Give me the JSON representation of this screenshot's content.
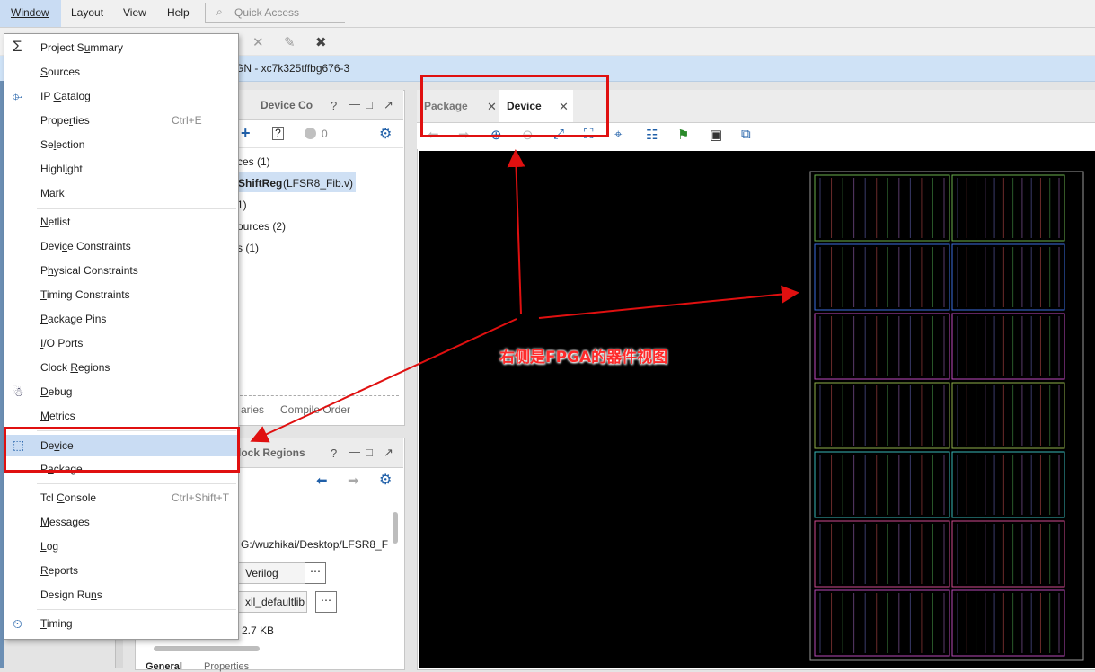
{
  "menubar": {
    "window": "Window",
    "layout": "Layout",
    "view": "View",
    "help": "Help",
    "quick_access": "Quick Access"
  },
  "project_bar": {
    "title": "GN - xc7k325tffbg676-3"
  },
  "sources_panel": {
    "tabs": [
      "t",
      "Device Co"
    ],
    "badge_count": "0",
    "rows": [
      "ces (1)",
      "ShiftReg",
      "(LFSR8_Fib.v)",
      "1)",
      "ources (2)",
      "s (1)"
    ],
    "footer_tabs": [
      "aries",
      "Compile Order"
    ]
  },
  "properties_panel": {
    "tab": "lock Regions",
    "location": "G:/wuzhikai/Desktop/LFSR8_F",
    "file_type": "Verilog",
    "library": "xil_defaultlib",
    "size": "2.7 KB",
    "bottom_tabs": [
      "General",
      "Properties"
    ]
  },
  "device_panel": {
    "tabs": [
      "Package",
      "Device"
    ],
    "active_tab": "Device"
  },
  "window_menu": {
    "items": [
      {
        "label": "Project Summary",
        "icon": "sigma-icon"
      },
      {
        "label": "Sources",
        "icon": ""
      },
      {
        "label": "IP Catalog",
        "icon": "ip-plug-icon"
      },
      {
        "label": "Properties",
        "shortcut": "Ctrl+E"
      },
      {
        "label": "Selection"
      },
      {
        "label": "Highlight"
      },
      {
        "label": "Mark"
      },
      {
        "label": "Netlist"
      },
      {
        "label": "Device Constraints"
      },
      {
        "label": "Physical Constraints"
      },
      {
        "label": "Timing Constraints"
      },
      {
        "label": "Package Pins"
      },
      {
        "label": "I/O Ports"
      },
      {
        "label": "Clock Regions"
      },
      {
        "label": "Debug",
        "icon": "bug-icon"
      },
      {
        "label": "Metrics"
      },
      {
        "label": "Device",
        "icon": "chip-icon"
      },
      {
        "label": "Package"
      },
      {
        "label": "Tcl Console",
        "shortcut": "Ctrl+Shift+T"
      },
      {
        "label": "Messages"
      },
      {
        "label": "Log"
      },
      {
        "label": "Reports"
      },
      {
        "label": "Design Runs"
      },
      {
        "label": "Timing",
        "icon": "clock-icon"
      }
    ]
  },
  "annotation": {
    "text": "右侧是FPGA的器件视图"
  },
  "colors": {
    "accent": "#c9dcf3",
    "highlight_red": "#e01010",
    "device_bg": "#000000"
  }
}
